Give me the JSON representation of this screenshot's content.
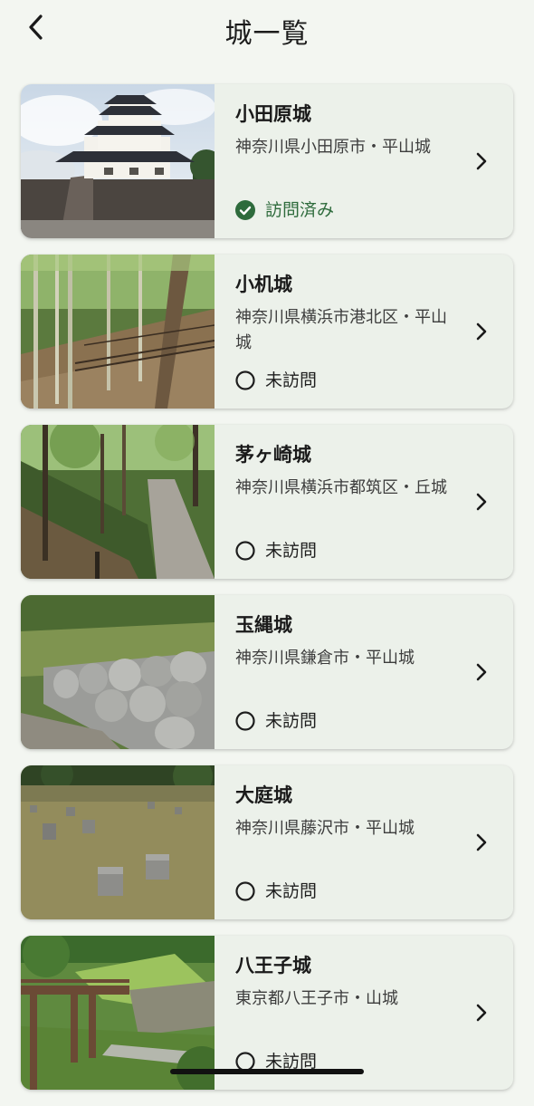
{
  "header": {
    "title": "城一覧",
    "back_icon": "chevron-left-icon"
  },
  "colors": {
    "background": "#f3f6f1",
    "card": "#ecf1ea",
    "visited": "#2e6b3c",
    "text": "#1e1e1e"
  },
  "castles": [
    {
      "name": "小田原城",
      "address": "神奈川県小田原市・平山城",
      "status": "訪問済み",
      "visited": true,
      "photo": "japanese-castle-keep-photo"
    },
    {
      "name": "小机城",
      "address": "神奈川県横浜市港北区・平山城",
      "status": "未訪問",
      "visited": false,
      "photo": "bamboo-forest-path-photo"
    },
    {
      "name": "茅ヶ崎城",
      "address": "神奈川県横浜市都筑区・丘城",
      "status": "未訪問",
      "visited": false,
      "photo": "forest-trail-photo"
    },
    {
      "name": "玉縄城",
      "address": "神奈川県鎌倉市・平山城",
      "status": "未訪問",
      "visited": false,
      "photo": "stone-wall-photo"
    },
    {
      "name": "大庭城",
      "address": "神奈川県藤沢市・平山城",
      "status": "未訪問",
      "visited": false,
      "photo": "foundation-stones-field-photo"
    },
    {
      "name": "八王子城",
      "address": "東京都八王子市・山城",
      "status": "未訪問",
      "visited": false,
      "photo": "wooden-bridge-photo"
    }
  ]
}
